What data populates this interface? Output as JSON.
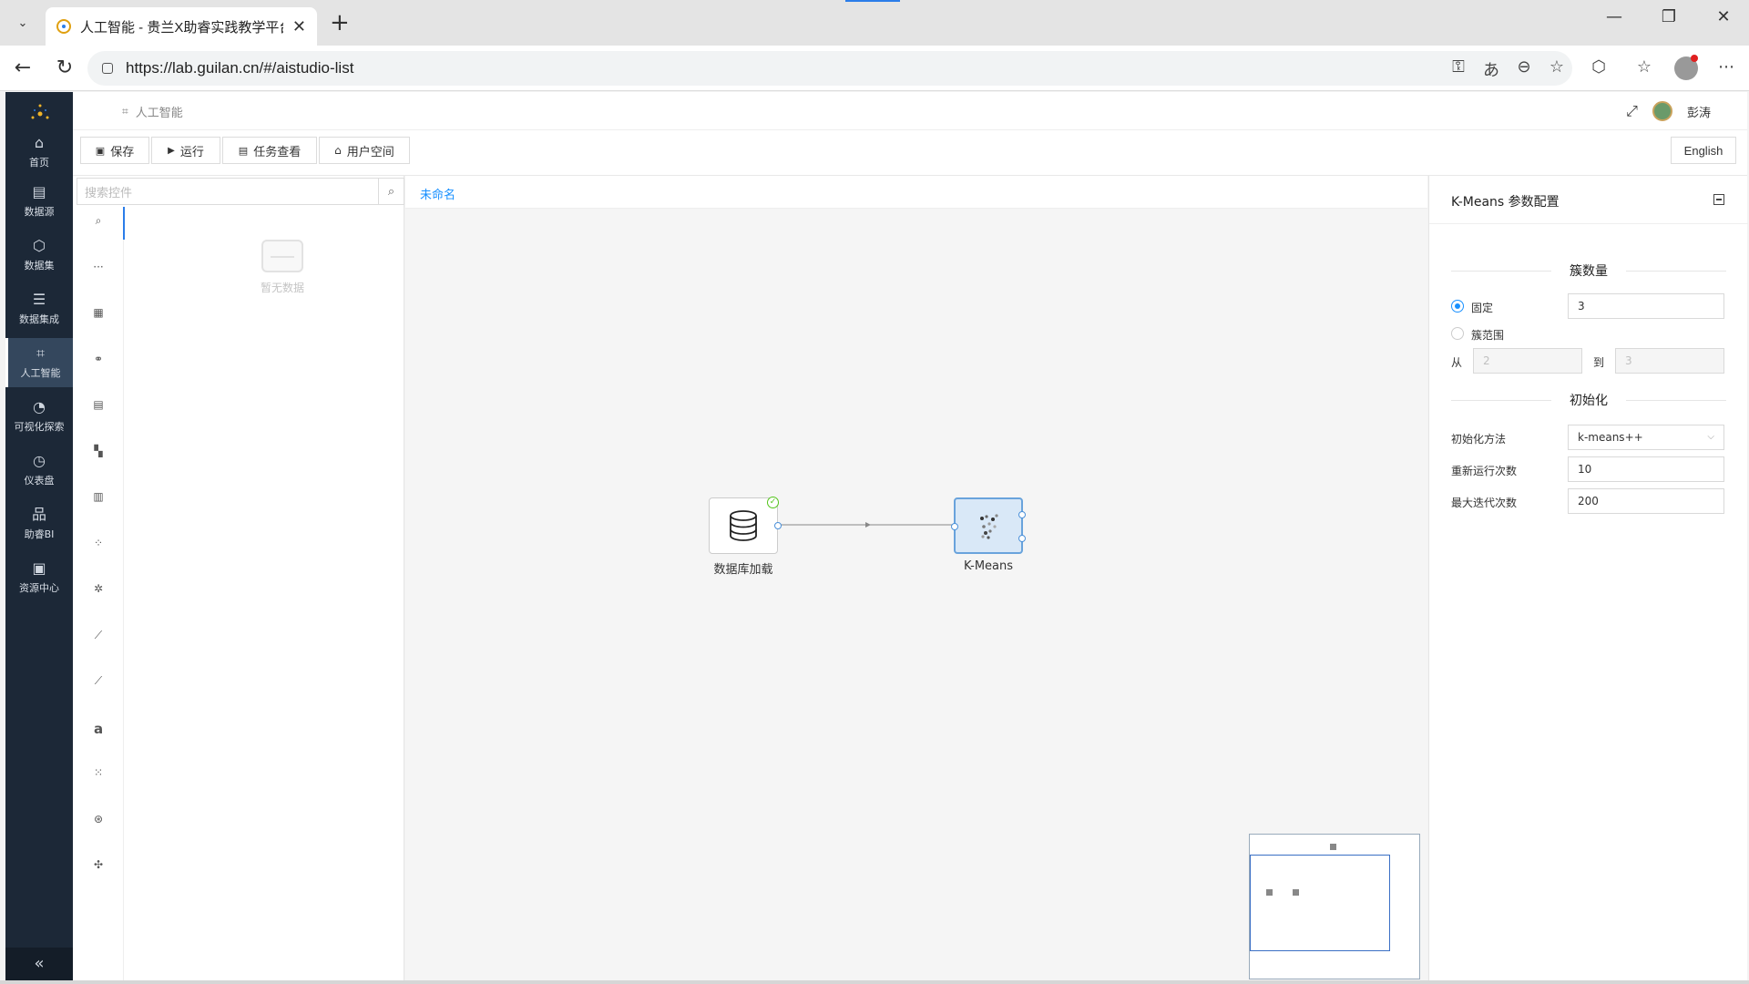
{
  "browser": {
    "tab_title": "人工智能 - 贵兰X助睿实践教学平台",
    "url": "https://lab.guilan.cn/#/aistudio-list"
  },
  "sidebar": {
    "items": [
      {
        "label": "首页",
        "icon": "home-icon",
        "glyph": "⌂"
      },
      {
        "label": "数据源",
        "icon": "database-icon",
        "glyph": "▤"
      },
      {
        "label": "数据集",
        "icon": "cube-icon",
        "glyph": "⬡"
      },
      {
        "label": "数据集成",
        "icon": "integration-icon",
        "glyph": "☰"
      },
      {
        "label": "人工智能",
        "icon": "ai-icon",
        "glyph": "⌗"
      },
      {
        "label": "可视化探索",
        "icon": "pie-chart-icon",
        "glyph": "◔"
      },
      {
        "label": "仪表盘",
        "icon": "gauge-icon",
        "glyph": "◷"
      },
      {
        "label": "助睿BI",
        "icon": "org-chart-icon",
        "glyph": "品"
      },
      {
        "label": "资源中心",
        "icon": "resource-icon",
        "glyph": "▣"
      }
    ],
    "active": "人工智能",
    "collapse_glyph": "«"
  },
  "header": {
    "breadcrumb": "人工智能",
    "username": "彭涛"
  },
  "toolbar": {
    "save": "保存",
    "run": "运行",
    "tasks": "任务查看",
    "user_space": "用户空间",
    "language": "English"
  },
  "components": {
    "search_placeholder": "搜索控件",
    "empty_text": "暂无数据",
    "rail_icons": [
      "search-icon",
      "more-icon",
      "table-icon",
      "link-icon",
      "card-icon",
      "grid-icon",
      "bar-icon",
      "scatter-icon",
      "tree-icon",
      "line-chart-icon",
      "area-chart-icon",
      "text-icon",
      "cluster-icon",
      "atom-icon",
      "network-icon"
    ]
  },
  "canvas": {
    "tab": "未命名",
    "nodes": [
      {
        "label": "数据库加载",
        "status": "success"
      },
      {
        "label": "K-Means",
        "status": "selected"
      }
    ]
  },
  "params": {
    "title": "K-Means 参数配置",
    "clusters_section": "簇数量",
    "fixed_label": "固定",
    "fixed_value": "3",
    "range_label": "簇范围",
    "from_label": "从",
    "from_value": "2",
    "to_label": "到",
    "to_value": "3",
    "init_section": "初始化",
    "init_method_label": "初始化方法",
    "init_method_value": "k-means++",
    "rerun_label": "重新运行次数",
    "rerun_value": "10",
    "max_iter_label": "最大迭代次数",
    "max_iter_value": "200"
  }
}
